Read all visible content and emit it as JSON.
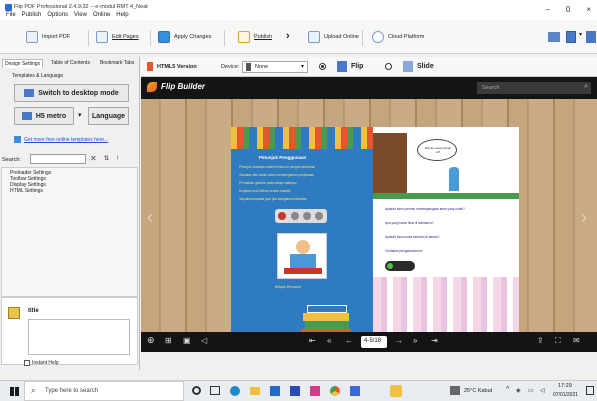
{
  "window": {
    "title": "Flip PDF Professional 2.4.9.32 -- e-modul RMT 4_Neat",
    "menu": [
      "File",
      "Publish",
      "Options",
      "View",
      "Online",
      "Help"
    ],
    "controls": [
      "–",
      "0",
      "×"
    ]
  },
  "toolbar": {
    "import": "Import PDF",
    "edit": "Edit Pages",
    "apply": "Apply Changes",
    "publish": "Publish",
    "upload": "Upload Online",
    "cloud": "Cloud Platform"
  },
  "left": {
    "tabs": [
      "Design Settings",
      "Table of Contents",
      "Bookmark Tabs"
    ],
    "subtab": "Templates & Language",
    "switch_btn": "Switch to desktop mode",
    "h5": "H5 metro",
    "language": "Language",
    "more_link": "Get more free online templates here...",
    "search_label": "Search:",
    "tree": [
      "Preloader Settings",
      "Toolbar Settings",
      "Display Settings",
      "HTML Settings"
    ],
    "title_label": "title",
    "instant_help": "Instant Help"
  },
  "htmlbar": {
    "version": "HTML5 Version",
    "device_label": "Device:",
    "device_value": "None",
    "flip": "Flip",
    "slide": "Slide"
  },
  "viewer": {
    "brand": "Flip Builder",
    "search_placeholder": "Search",
    "page_indicator": "4-5/18"
  },
  "book": {
    "left_heading": "Petunjuk Penggunaan",
    "left_lines": [
      "Petunjuk: Bacalah materi berikut ini dengan seksama!",
      "Gunakan fitur audio untuk mendengarkan penjelasan",
      "Perhatikan gambar pada setiap halaman",
      "Kerjakan soal latihan secara mandiri",
      "Tanyakan kepada guru jika mengalami kesulitan"
    ],
    "left_caption": "Belajar Bersama",
    "speech": "Mau ke mana ya hari ini?",
    "right_lines": [
      "Apakah kamu pernah membayangkan alam yang indah?",
      "Apa yang kamu lihat di sekitarmu?",
      "Apakah kamu suka bermain di taman?",
      "Ceritakan pengalamanmu!"
    ]
  },
  "taskbar": {
    "search_placeholder": "Type here to search",
    "weather": "25°C  Kabut",
    "time": "17:29",
    "date": "07/01/2021"
  }
}
